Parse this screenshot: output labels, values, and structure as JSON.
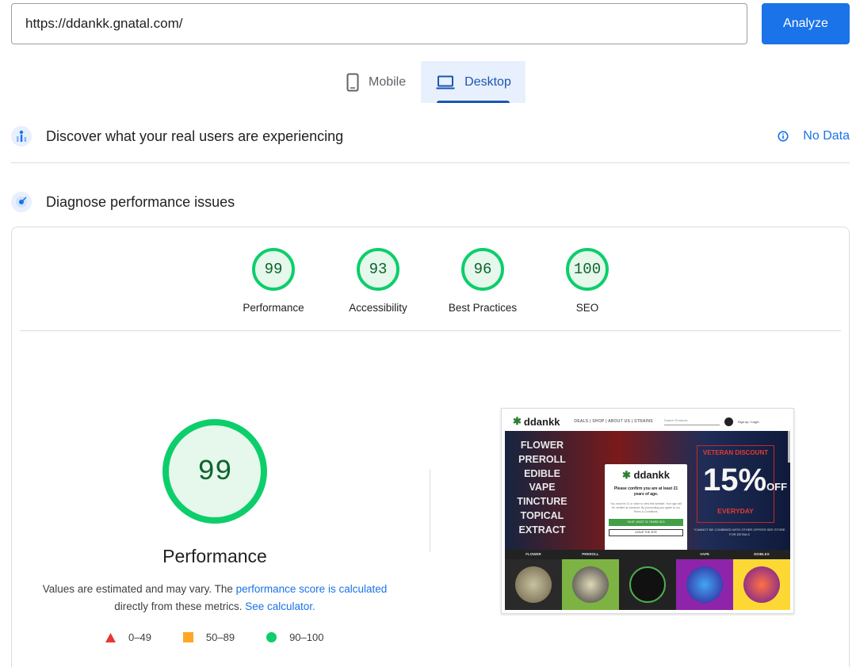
{
  "url_bar": {
    "value": "https://ddankk.gnatal.com/",
    "analyze_label": "Analyze"
  },
  "tabs": [
    {
      "label": "Mobile",
      "icon": "phone-icon",
      "active": false
    },
    {
      "label": "Desktop",
      "icon": "laptop-icon",
      "active": true
    }
  ],
  "field_data": {
    "title": "Discover what your real users are experiencing",
    "status": "No Data"
  },
  "lab": {
    "title": "Diagnose performance issues"
  },
  "scores": [
    {
      "value": "99",
      "label": "Performance"
    },
    {
      "value": "93",
      "label": "Accessibility"
    },
    {
      "value": "96",
      "label": "Best Practices"
    },
    {
      "value": "100",
      "label": "SEO"
    }
  ],
  "performance": {
    "score": "99",
    "title": "Performance",
    "note_prefix": "Values are estimated and may vary. The ",
    "note_link1": "performance score is calculated",
    "note_mid": " directly from these metrics. ",
    "note_link2": "See calculator."
  },
  "legend": [
    {
      "range": "0–49",
      "shape": "triangle",
      "color": "#e53935"
    },
    {
      "range": "50–89",
      "shape": "square",
      "color": "#ffa726"
    },
    {
      "range": "90–100",
      "shape": "circle",
      "color": "#0cce6b"
    }
  ],
  "preview": {
    "brand": "ddankk",
    "menu": "DEALS | SHOP | ABOUT US | STRAINS",
    "search_placeholder": "Search Products",
    "sign_in": "Sign up / Login",
    "hero_items": [
      "FLOWER",
      "PREROLL",
      "EDIBLE",
      "VAPE",
      "TINCTURE",
      "TOPICAL",
      "EXTRACT"
    ],
    "promo_top": "VETERAN DISCOUNT",
    "promo_pct": "15%",
    "promo_off": "OFF",
    "promo_bottom": "EVERYDAY",
    "promo_fine": "*CANNOT BE COMBINED WITH OTHER OFFERS SEE STORE FOR DETAILS",
    "modal_question": "Please confirm you are at least 21 years of age.",
    "modal_small": "You must be 21 or older to view this website. Your age will be verified at checkout. By proceeding you agree to our Terms & Conditions.",
    "modal_confirm": "I'M AT LEAST 21 YEARS OLD",
    "modal_leave": "LEAVE THE SITE",
    "categories": [
      "FLOWER",
      "PREROLL",
      "",
      "VAPE",
      "EDIBLES"
    ]
  }
}
